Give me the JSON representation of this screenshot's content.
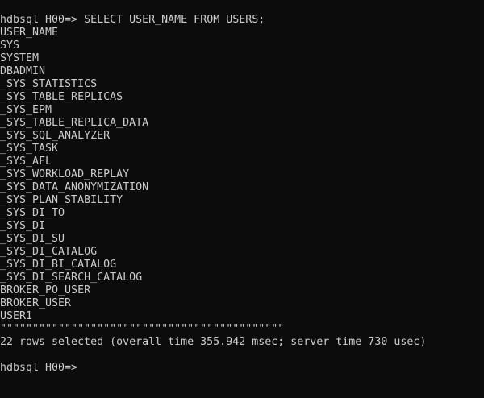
{
  "command": {
    "prompt": "hdbsql H00=>",
    "text": "SELECT USER_NAME FROM USERS;"
  },
  "result": {
    "header": "USER_NAME",
    "rows": [
      "SYS",
      "SYSTEM",
      "DBADMIN",
      "_SYS_STATISTICS",
      "_SYS_TABLE_REPLICAS",
      "_SYS_EPM",
      "_SYS_TABLE_REPLICA_DATA",
      "_SYS_SQL_ANALYZER",
      "_SYS_TASK",
      "_SYS_AFL",
      "_SYS_WORKLOAD_REPLAY",
      "_SYS_DATA_ANONYMIZATION",
      "_SYS_PLAN_STABILITY",
      "_SYS_DI_TO",
      "_SYS_DI",
      "_SYS_DI_SU",
      "_SYS_DI_CATALOG",
      "_SYS_DI_BI_CATALOG",
      "_SYS_DI_SEARCH_CATALOG",
      "BROKER_PO_USER",
      "BROKER_USER",
      "USER1"
    ],
    "separator": "\"\"\"\"\"\"\"\"\"\"\"\"\"\"\"\"\"\"\"\"\"\"\"\"\"\"\"\"\"\"\"\"\"\"\"\"\"\"\"\"\"\"\"\"",
    "summary": "22 rows selected (overall time 355.942 msec; server time 730 usec)"
  },
  "next_prompt": "hdbsql H00=>"
}
